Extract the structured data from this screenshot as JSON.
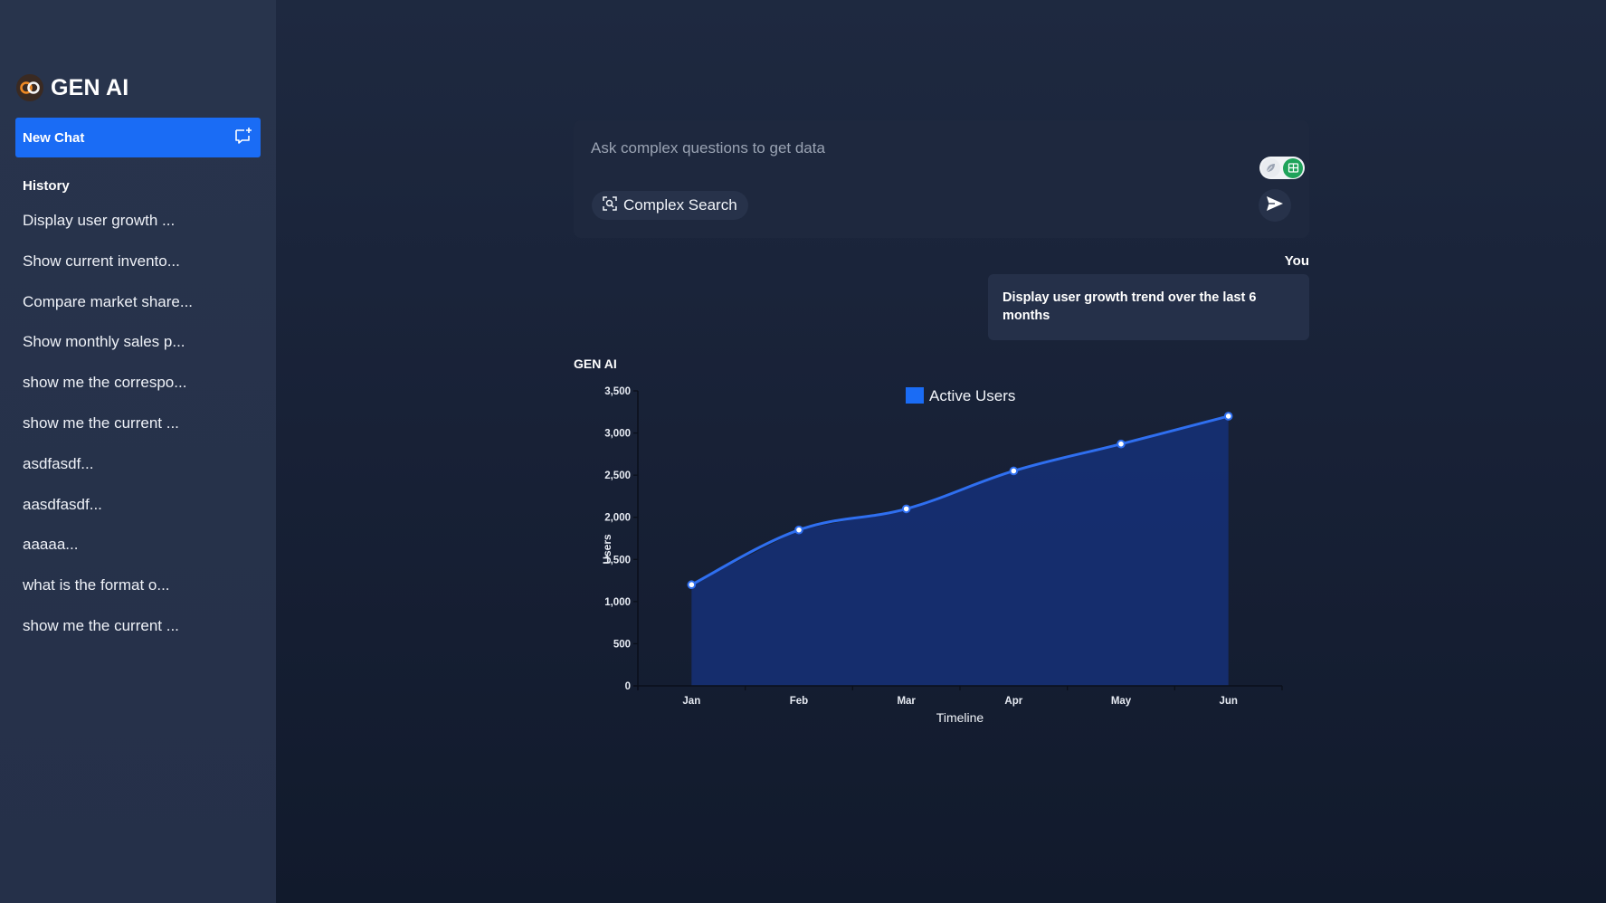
{
  "brand": {
    "name": "GEN AI"
  },
  "sidebar": {
    "new_chat_label": "New Chat",
    "history_title": "History",
    "history": [
      "Display user growth ...",
      "Show current invento...",
      "Compare market share...",
      "Show monthly sales p...",
      "show me the correspo...",
      "show me the current ...",
      "asdfasdf...",
      "aasdfasdf...",
      "aaaaa...",
      "what is the format o...",
      "show me the current ..."
    ]
  },
  "search": {
    "placeholder": "Ask complex questions to get data",
    "complex_search_label": "Complex Search"
  },
  "conversation": {
    "user_label": "You",
    "user_message": "Display user growth trend over the last 6 months",
    "assistant_label": "GEN AI"
  },
  "colors": {
    "accent": "#1a6cf5",
    "series": "#2f6ff0",
    "area_fill": "#153078"
  },
  "chart_data": {
    "type": "area",
    "categories": [
      "Jan",
      "Feb",
      "Mar",
      "Apr",
      "May",
      "Jun"
    ],
    "series": [
      {
        "name": "Active Users",
        "values": [
          1200,
          1850,
          2100,
          2550,
          2870,
          3200
        ]
      }
    ],
    "xlabel": "Timeline",
    "ylabel": "Users",
    "ylim": [
      0,
      3500
    ],
    "yticks": [
      "0",
      "500",
      "1,000",
      "1,500",
      "2,000",
      "2,500",
      "3,000",
      "3,500"
    ],
    "legend_position": "top-center",
    "grid": false
  }
}
